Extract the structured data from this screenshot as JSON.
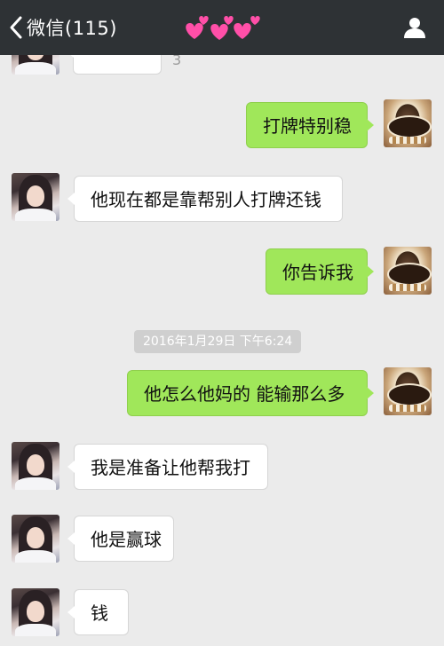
{
  "header": {
    "back_label": "微信(115)"
  },
  "chat": {
    "timestamp": "2016年1月29日 下午6:24",
    "stray_char": "3",
    "messages": [
      {
        "from": "other",
        "text": ""
      },
      {
        "from": "me",
        "text": "打牌特别稳"
      },
      {
        "from": "other",
        "text": "他现在都是靠帮别人打牌还钱"
      },
      {
        "from": "me",
        "text": "你告诉我"
      },
      {
        "from": "me",
        "text": "他怎么他妈的 能输那么多"
      },
      {
        "from": "other",
        "text": "我是准备让他帮我打"
      },
      {
        "from": "other",
        "text": "他是赢球"
      },
      {
        "from": "other",
        "text": "钱"
      }
    ]
  },
  "colors": {
    "navbar": "#2e3235",
    "background": "#ebebeb",
    "bubble_me": "#a0e75a",
    "bubble_other": "#ffffff",
    "hearts": "#ff4fa8"
  },
  "icons": {
    "back": "chevron-left-icon",
    "hearts": "hearts-emoji-icon",
    "profile": "person-icon"
  }
}
